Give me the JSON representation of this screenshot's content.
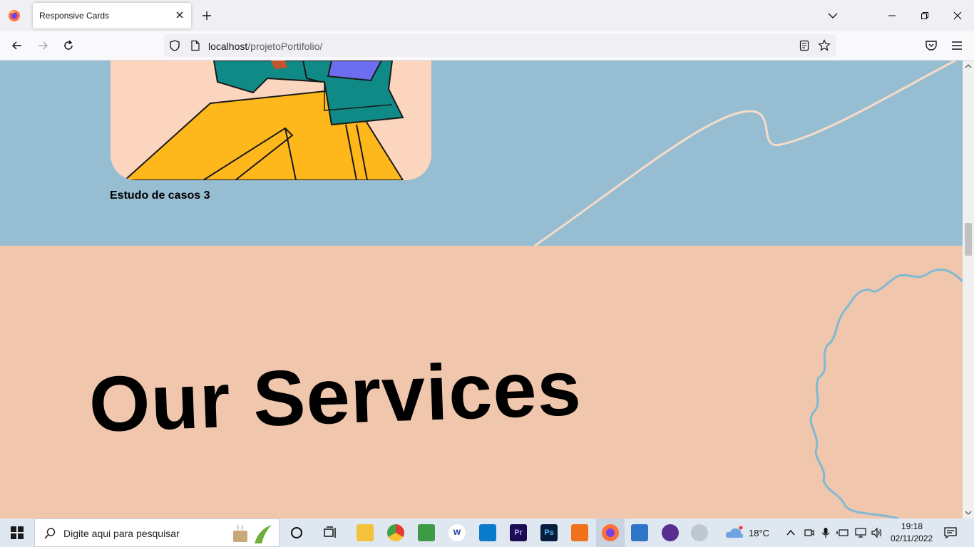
{
  "browser": {
    "tab_title": "Responsive Cards",
    "url_host": "localhost",
    "url_path": "/projetoPortifolio/"
  },
  "page": {
    "card_caption": "Estudo de casos 3",
    "services_title": "Our Services"
  },
  "taskbar": {
    "search_placeholder": "Digite aqui para pesquisar",
    "weather_temp": "18°C",
    "time": "19:18",
    "date": "02/11/2022"
  },
  "colors": {
    "section_blue": "#97bdd2",
    "section_peach": "#f0c6ad",
    "card_bg": "#fbd5bd",
    "squiggle": "#7fbad3",
    "curve": "#f6dcc8"
  }
}
